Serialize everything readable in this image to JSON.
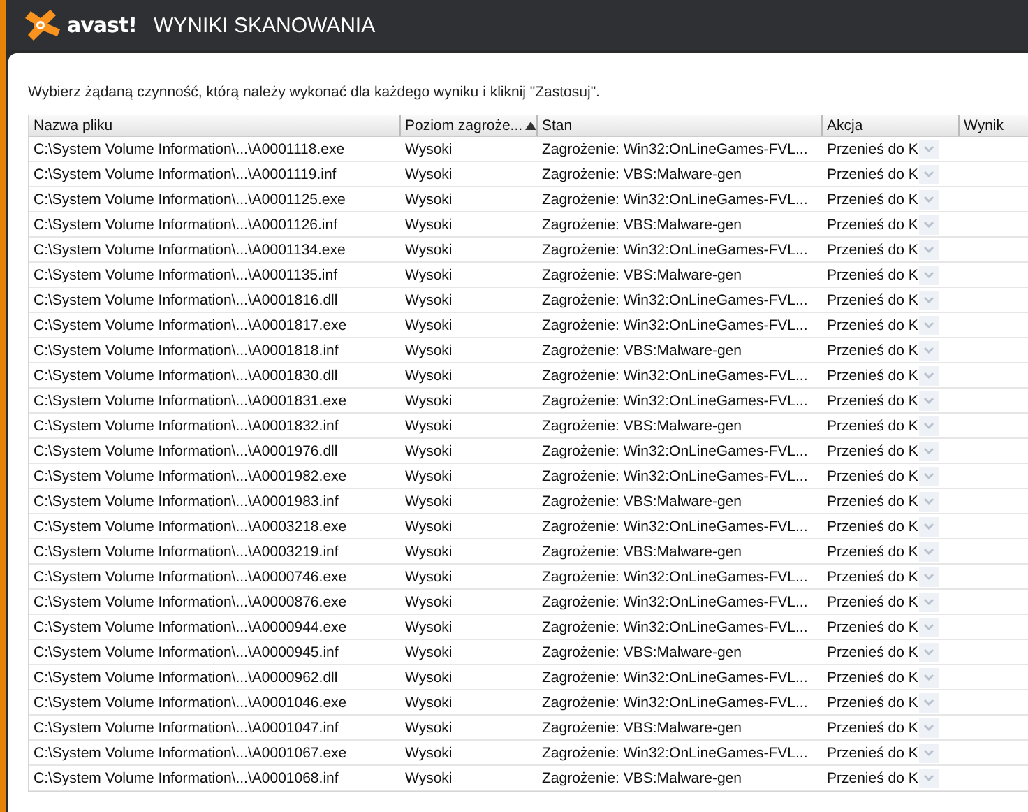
{
  "header": {
    "logo": "avast!",
    "title": "WYNIKI SKANOWANIA"
  },
  "instruction": "Wybierz żądaną czynność, którą należy wykonać dla każdego wyniku i kliknij \"Zastosuj\".",
  "table": {
    "columns": [
      {
        "label": "Nazwa pliku",
        "sorted": false
      },
      {
        "label": "Poziom zagroże...",
        "sorted": true
      },
      {
        "label": "Stan",
        "sorted": false
      },
      {
        "label": "Akcja",
        "sorted": false
      },
      {
        "label": "Wynik",
        "sorted": false
      }
    ],
    "rows": [
      {
        "file": "C:\\System Volume Information\\...\\A0001118.exe",
        "level": "Wysoki",
        "status": "Zagrożenie: Win32:OnLineGames-FVL...",
        "action": "Przenieś do K"
      },
      {
        "file": "C:\\System Volume Information\\...\\A0001119.inf",
        "level": "Wysoki",
        "status": "Zagrożenie: VBS:Malware-gen",
        "action": "Przenieś do K"
      },
      {
        "file": "C:\\System Volume Information\\...\\A0001125.exe",
        "level": "Wysoki",
        "status": "Zagrożenie: Win32:OnLineGames-FVL...",
        "action": "Przenieś do K"
      },
      {
        "file": "C:\\System Volume Information\\...\\A0001126.inf",
        "level": "Wysoki",
        "status": "Zagrożenie: VBS:Malware-gen",
        "action": "Przenieś do K"
      },
      {
        "file": "C:\\System Volume Information\\...\\A0001134.exe",
        "level": "Wysoki",
        "status": "Zagrożenie: Win32:OnLineGames-FVL...",
        "action": "Przenieś do K"
      },
      {
        "file": "C:\\System Volume Information\\...\\A0001135.inf",
        "level": "Wysoki",
        "status": "Zagrożenie: VBS:Malware-gen",
        "action": "Przenieś do K"
      },
      {
        "file": "C:\\System Volume Information\\...\\A0001816.dll",
        "level": "Wysoki",
        "status": "Zagrożenie: Win32:OnLineGames-FVL...",
        "action": "Przenieś do K"
      },
      {
        "file": "C:\\System Volume Information\\...\\A0001817.exe",
        "level": "Wysoki",
        "status": "Zagrożenie: Win32:OnLineGames-FVL...",
        "action": "Przenieś do K"
      },
      {
        "file": "C:\\System Volume Information\\...\\A0001818.inf",
        "level": "Wysoki",
        "status": "Zagrożenie: VBS:Malware-gen",
        "action": "Przenieś do K"
      },
      {
        "file": "C:\\System Volume Information\\...\\A0001830.dll",
        "level": "Wysoki",
        "status": "Zagrożenie: Win32:OnLineGames-FVL...",
        "action": "Przenieś do K"
      },
      {
        "file": "C:\\System Volume Information\\...\\A0001831.exe",
        "level": "Wysoki",
        "status": "Zagrożenie: Win32:OnLineGames-FVL...",
        "action": "Przenieś do K"
      },
      {
        "file": "C:\\System Volume Information\\...\\A0001832.inf",
        "level": "Wysoki",
        "status": "Zagrożenie: VBS:Malware-gen",
        "action": "Przenieś do K"
      },
      {
        "file": "C:\\System Volume Information\\...\\A0001976.dll",
        "level": "Wysoki",
        "status": "Zagrożenie: Win32:OnLineGames-FVL...",
        "action": "Przenieś do K"
      },
      {
        "file": "C:\\System Volume Information\\...\\A0001982.exe",
        "level": "Wysoki",
        "status": "Zagrożenie: Win32:OnLineGames-FVL...",
        "action": "Przenieś do K"
      },
      {
        "file": "C:\\System Volume Information\\...\\A0001983.inf",
        "level": "Wysoki",
        "status": "Zagrożenie: VBS:Malware-gen",
        "action": "Przenieś do K"
      },
      {
        "file": "C:\\System Volume Information\\...\\A0003218.exe",
        "level": "Wysoki",
        "status": "Zagrożenie: Win32:OnLineGames-FVL...",
        "action": "Przenieś do K"
      },
      {
        "file": "C:\\System Volume Information\\...\\A0003219.inf",
        "level": "Wysoki",
        "status": "Zagrożenie: VBS:Malware-gen",
        "action": "Przenieś do K"
      },
      {
        "file": "C:\\System Volume Information\\...\\A0000746.exe",
        "level": "Wysoki",
        "status": "Zagrożenie: Win32:OnLineGames-FVL...",
        "action": "Przenieś do K"
      },
      {
        "file": "C:\\System Volume Information\\...\\A0000876.exe",
        "level": "Wysoki",
        "status": "Zagrożenie: Win32:OnLineGames-FVL...",
        "action": "Przenieś do K"
      },
      {
        "file": "C:\\System Volume Information\\...\\A0000944.exe",
        "level": "Wysoki",
        "status": "Zagrożenie: Win32:OnLineGames-FVL...",
        "action": "Przenieś do K"
      },
      {
        "file": "C:\\System Volume Information\\...\\A0000945.inf",
        "level": "Wysoki",
        "status": "Zagrożenie: VBS:Malware-gen",
        "action": "Przenieś do K"
      },
      {
        "file": "C:\\System Volume Information\\...\\A0000962.dll",
        "level": "Wysoki",
        "status": "Zagrożenie: Win32:OnLineGames-FVL...",
        "action": "Przenieś do K"
      },
      {
        "file": "C:\\System Volume Information\\...\\A0001046.exe",
        "level": "Wysoki",
        "status": "Zagrożenie: Win32:OnLineGames-FVL...",
        "action": "Przenieś do K"
      },
      {
        "file": "C:\\System Volume Information\\...\\A0001047.inf",
        "level": "Wysoki",
        "status": "Zagrożenie: VBS:Malware-gen",
        "action": "Przenieś do K"
      },
      {
        "file": "C:\\System Volume Information\\...\\A0001067.exe",
        "level": "Wysoki",
        "status": "Zagrożenie: Win32:OnLineGames-FVL...",
        "action": "Przenieś do K"
      },
      {
        "file": "C:\\System Volume Information\\...\\A0001068.inf",
        "level": "Wysoki",
        "status": "Zagrożenie: VBS:Malware-gen",
        "action": "Przenieś do K"
      }
    ]
  }
}
